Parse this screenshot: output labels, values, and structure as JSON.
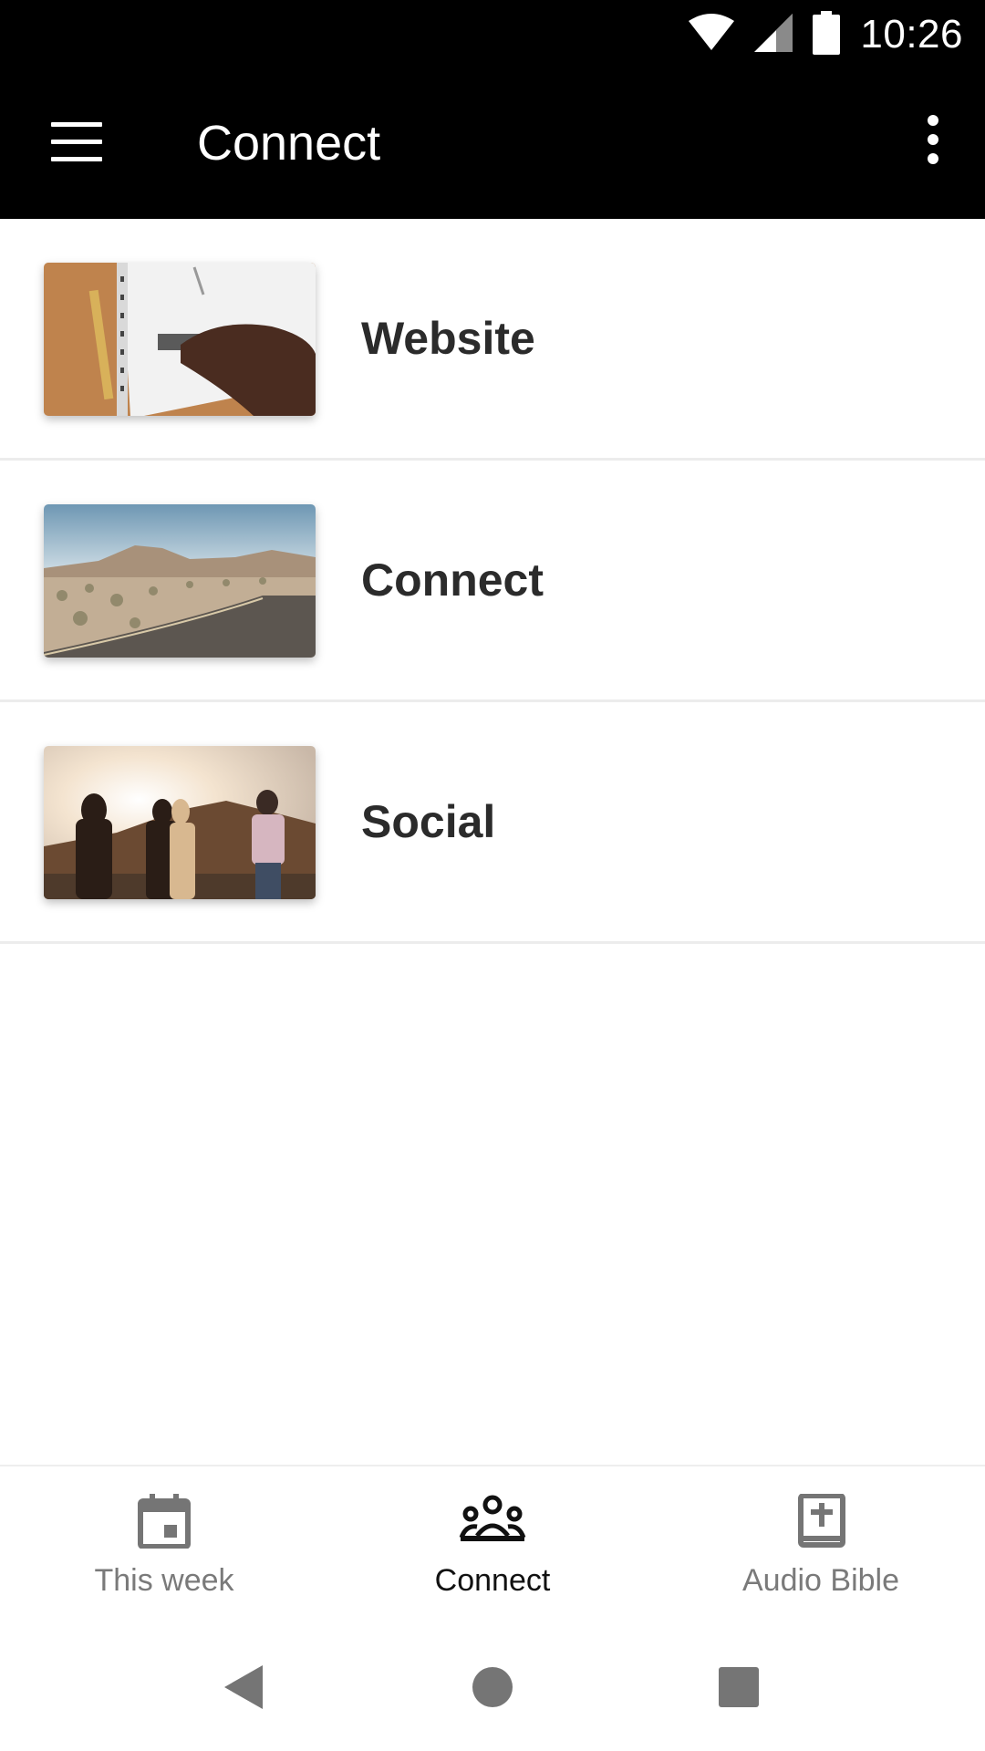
{
  "status_bar": {
    "time": "10:26",
    "icons": [
      "wifi-icon",
      "cell-signal-icon",
      "battery-icon"
    ]
  },
  "app_bar": {
    "title": "Connect",
    "menu_icon": "hamburger-menu-icon",
    "overflow_icon": "more-vert-icon"
  },
  "list": {
    "items": [
      {
        "label": "Website",
        "thumbnail": "notebook-writing-photo"
      },
      {
        "label": "Connect",
        "thumbnail": "desert-road-photo"
      },
      {
        "label": "Social",
        "thumbnail": "people-sunset-photo"
      }
    ]
  },
  "bottom_nav": {
    "items": [
      {
        "label": "This week",
        "icon": "calendar-icon",
        "active": false
      },
      {
        "label": "Connect",
        "icon": "group-icon",
        "active": true
      },
      {
        "label": "Audio Bible",
        "icon": "bible-book-icon",
        "active": false
      }
    ],
    "active_color": "#111111",
    "inactive_color": "#7a7a7a"
  },
  "system_nav": {
    "buttons": [
      "back-icon",
      "home-icon",
      "recents-icon"
    ]
  },
  "colors": {
    "app_bar_bg": "#000000",
    "divider": "#ececec",
    "label_text": "#2b2b2b"
  }
}
